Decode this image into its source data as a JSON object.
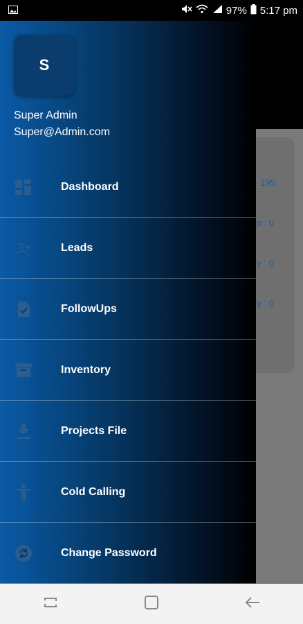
{
  "status_bar": {
    "battery": "97%",
    "time": "5:17 pm",
    "icons": [
      "gallery-icon",
      "mute-icon",
      "wifi-icon",
      "signal-icon",
      "battery-icon"
    ]
  },
  "drawer": {
    "avatar_letter": "S",
    "user_name": "Super Admin",
    "user_email": "Super@Admin.com",
    "menu": [
      {
        "label": "Dashboard",
        "icon": "dashboard-icon"
      },
      {
        "label": "Leads",
        "icon": "add-person-icon"
      },
      {
        "label": "FollowUps",
        "icon": "document-check-icon"
      },
      {
        "label": "Inventory",
        "icon": "archive-icon"
      },
      {
        "label": "Projects File",
        "icon": "download-icon"
      },
      {
        "label": "Cold Calling",
        "icon": "person-icon"
      },
      {
        "label": "Change Password",
        "icon": "sync-icon"
      }
    ]
  },
  "background_card": {
    "values": [
      "195",
      "p : 0",
      "y : 0",
      "y : 0"
    ],
    "accent": "#1a5fa8"
  },
  "colors": {
    "drawer_gradient_start": "#0a5aa5",
    "drawer_gradient_end": "#000000",
    "navbar": "#f3f3f3"
  }
}
